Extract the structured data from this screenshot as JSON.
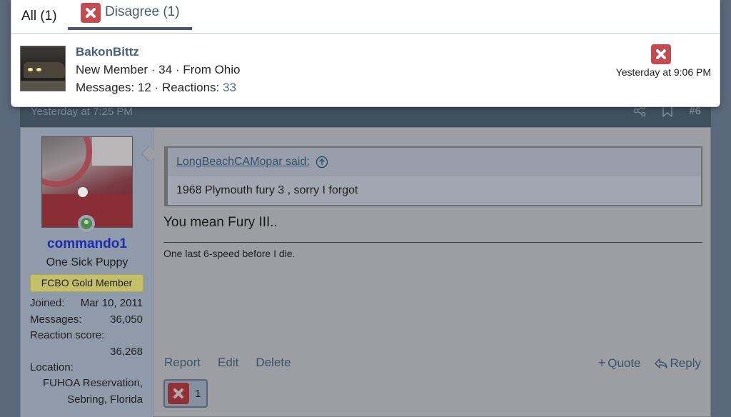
{
  "popup": {
    "tabs": [
      {
        "label": "All (1)"
      },
      {
        "label": "Disagree (1)"
      }
    ],
    "reactor": {
      "name": "BakonBittz",
      "info": "New Member · 34 · From Ohio",
      "messages_label": "Messages: 12 · Reactions:",
      "reactions_value": "33",
      "reaction_icon": "disagree-x-icon",
      "time": "Yesterday at 9:06 PM"
    }
  },
  "post": {
    "date": "Yesterday at 7:25 PM",
    "number": "#6",
    "user": {
      "name": "commando1",
      "title": "One Sick Puppy",
      "banner": "FCBO Gold Member",
      "joined_label": "Joined:",
      "joined_value": "Mar 10, 2011",
      "messages_label": "Messages:",
      "messages_value": "36,050",
      "reaction_label": "Reaction score:",
      "reaction_value": "36,268",
      "location_label": "Location:",
      "location_line1": "FUHOA Reservation,",
      "location_line2": "Sebring, Florida"
    },
    "quote": {
      "author": "LongBeachCAMopar said:",
      "text": "1968 Plymouth fury 3 , sorry I forgot"
    },
    "message": "You mean Fury III..",
    "signature": "One last 6-speed before I die.",
    "actions": {
      "report": "Report",
      "edit": "Edit",
      "delete": "Delete",
      "quote": "Quote",
      "reply": "Reply"
    },
    "reaction_count": "1"
  },
  "colors": {
    "disagree_red": "#c44b4f",
    "accent": "#47596e",
    "username_blue": "#1d2dae"
  }
}
